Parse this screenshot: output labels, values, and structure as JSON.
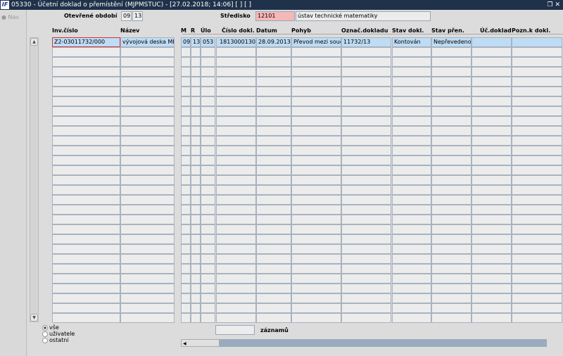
{
  "window": {
    "title": "05330 - Účetní doklad o přemístění (MJPMSTUC) - [27.02.2018; 14:06]  [ ]  [ ]",
    "logo": "IF",
    "restore_icon": "restore-icon",
    "close_icon": "close-icon",
    "restore": "❐",
    "close": "✕"
  },
  "nav": {
    "label": "Nav"
  },
  "header": {
    "period_label": "Otevřené období",
    "period_month": "09",
    "period_year": "13",
    "center_label": "Středisko",
    "center_code": "12101",
    "center_name": "ústav technické matematiky"
  },
  "columns": [
    "Inv.číslo",
    "Název",
    "M",
    "R",
    "Úlo",
    "Číslo dokl.",
    "Datum",
    "Pohyb",
    "Označ.dokladu",
    "Stav dokl.",
    "Stav přen.",
    "Úč.doklad",
    "Pozn.k dokl."
  ],
  "rows": [
    [
      "Z2-03011732/000",
      "vývojová deska ML",
      "09",
      "13",
      "053",
      "1813000130",
      "28.09.2013",
      "Převod mezi souč",
      "11732/13",
      "Kontován",
      "Nepřevedeno",
      "",
      ""
    ]
  ],
  "empty_rows": 28,
  "footer": {
    "filter_options": [
      {
        "label": "vše",
        "selected": true
      },
      {
        "label": "uživatele",
        "selected": false
      },
      {
        "label": "ostatni",
        "selected": false
      }
    ],
    "count_value": "",
    "count_label": "záznamů"
  },
  "colors": {
    "titlebar": "#20324a",
    "selected_row": "#bfdcf5",
    "center_code_bg": "#f5b8b8"
  }
}
